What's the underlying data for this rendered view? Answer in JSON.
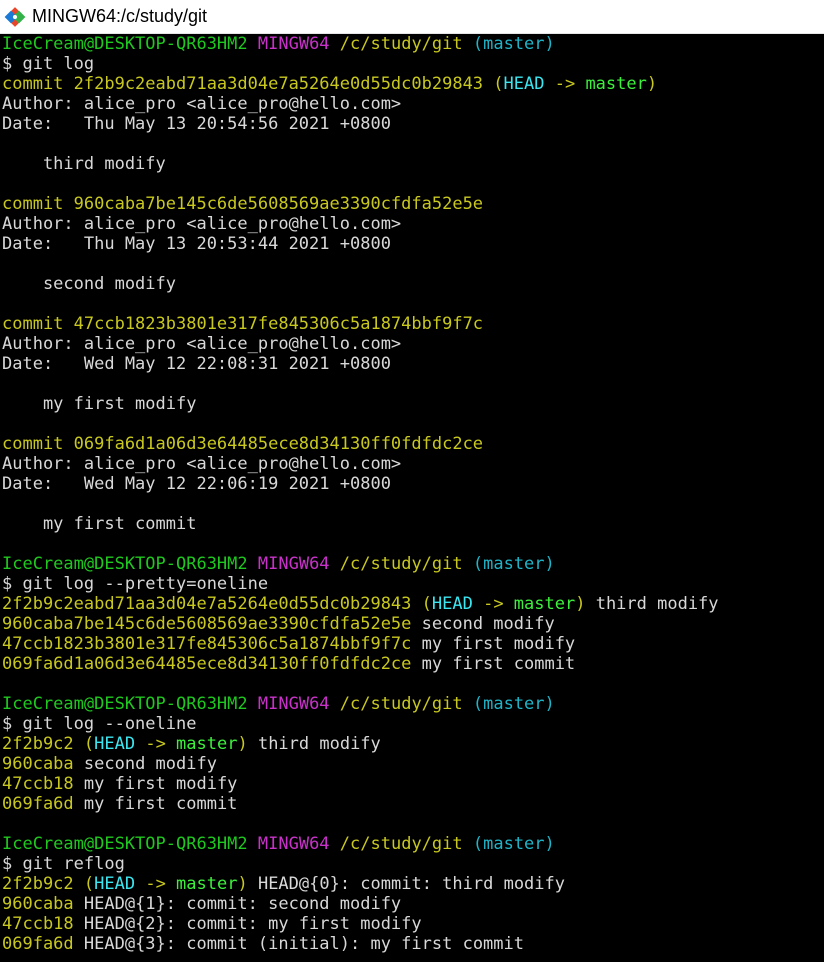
{
  "window": {
    "title": "MINGW64:/c/study/git"
  },
  "prompt": {
    "user_host": "IceCream@DESKTOP-QR63HM2",
    "system": "MINGW64",
    "path": "/c/study/git",
    "branch": "(master)"
  },
  "lines": [
    {
      "type": "prompt"
    },
    {
      "type": "cmd",
      "text": "$ git log"
    },
    {
      "type": "commit",
      "hash": "commit 2f2b9c2eabd71aa3d04e7a5264e0d55dc0b29843",
      "decor": true
    },
    {
      "type": "plain",
      "text": "Author: alice_pro <alice_pro@hello.com>"
    },
    {
      "type": "plain",
      "text": "Date:   Thu May 13 20:54:56 2021 +0800"
    },
    {
      "type": "blank"
    },
    {
      "type": "plain",
      "text": "    third modify"
    },
    {
      "type": "blank"
    },
    {
      "type": "commit",
      "hash": "commit 960caba7be145c6de5608569ae3390cfdfa52e5e"
    },
    {
      "type": "plain",
      "text": "Author: alice_pro <alice_pro@hello.com>"
    },
    {
      "type": "plain",
      "text": "Date:   Thu May 13 20:53:44 2021 +0800"
    },
    {
      "type": "blank"
    },
    {
      "type": "plain",
      "text": "    second modify"
    },
    {
      "type": "blank"
    },
    {
      "type": "commit",
      "hash": "commit 47ccb1823b3801e317fe845306c5a1874bbf9f7c"
    },
    {
      "type": "plain",
      "text": "Author: alice_pro <alice_pro@hello.com>"
    },
    {
      "type": "plain",
      "text": "Date:   Wed May 12 22:08:31 2021 +0800"
    },
    {
      "type": "blank"
    },
    {
      "type": "plain",
      "text": "    my first modify"
    },
    {
      "type": "blank"
    },
    {
      "type": "commit",
      "hash": "commit 069fa6d1a06d3e64485ece8d34130ff0fdfdc2ce"
    },
    {
      "type": "plain",
      "text": "Author: alice_pro <alice_pro@hello.com>"
    },
    {
      "type": "plain",
      "text": "Date:   Wed May 12 22:06:19 2021 +0800"
    },
    {
      "type": "blank"
    },
    {
      "type": "plain",
      "text": "    my first commit"
    },
    {
      "type": "blank"
    },
    {
      "type": "prompt"
    },
    {
      "type": "cmd",
      "text": "$ git log --pretty=oneline"
    },
    {
      "type": "hashline",
      "hash": "2f2b9c2eabd71aa3d04e7a5264e0d55dc0b29843",
      "decor": true,
      "rest": " third modify"
    },
    {
      "type": "hashline",
      "hash": "960caba7be145c6de5608569ae3390cfdfa52e5e",
      "rest": " second modify"
    },
    {
      "type": "hashline",
      "hash": "47ccb1823b3801e317fe845306c5a1874bbf9f7c",
      "rest": " my first modify"
    },
    {
      "type": "hashline",
      "hash": "069fa6d1a06d3e64485ece8d34130ff0fdfdc2ce",
      "rest": " my first commit"
    },
    {
      "type": "blank"
    },
    {
      "type": "prompt"
    },
    {
      "type": "cmd",
      "text": "$ git log --oneline"
    },
    {
      "type": "hashline",
      "hash": "2f2b9c2",
      "decor": true,
      "rest": " third modify"
    },
    {
      "type": "hashline",
      "hash": "960caba",
      "rest": " second modify"
    },
    {
      "type": "hashline",
      "hash": "47ccb18",
      "rest": " my first modify"
    },
    {
      "type": "hashline",
      "hash": "069fa6d",
      "rest": " my first commit"
    },
    {
      "type": "blank"
    },
    {
      "type": "prompt"
    },
    {
      "type": "cmd",
      "text": "$ git reflog"
    },
    {
      "type": "hashline",
      "hash": "2f2b9c2",
      "decor": true,
      "rest": " HEAD@{0}: commit: third modify"
    },
    {
      "type": "hashline",
      "hash": "960caba",
      "rest": " HEAD@{1}: commit: second modify"
    },
    {
      "type": "hashline",
      "hash": "47ccb18",
      "rest": " HEAD@{2}: commit: my first modify"
    },
    {
      "type": "hashline",
      "hash": "069fa6d",
      "rest": " HEAD@{3}: commit (initial): my first commit"
    }
  ],
  "decoration": {
    "open": " (",
    "head": "HEAD",
    "arrow": " -> ",
    "branch": "master",
    "close": ")"
  },
  "colors": {
    "background": "#000000",
    "text": "#c0c0c0",
    "user_host": "#1fc81f",
    "system": "#c832c8",
    "path": "#c8c81f",
    "branch": "#1fb4c8",
    "hash": "#c8c81f",
    "head": "#3ce6f0",
    "master": "#3cf03c"
  },
  "icons": {
    "app": "git-logo-icon"
  }
}
